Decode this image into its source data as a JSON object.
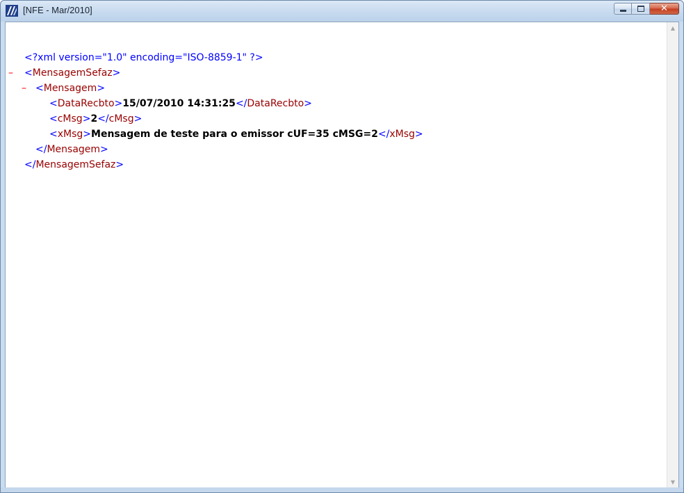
{
  "window": {
    "title": "[NFE - Mar/2010]",
    "icon": "app-logo-icon",
    "controls": [
      "minimize-icon",
      "maximize-icon",
      "close-icon"
    ]
  },
  "xml": {
    "pi": "<?xml version=\"1.0\" encoding=\"ISO-8859-1\" ?>",
    "collapse_glyph": "–",
    "root_open": "<MensagemSefaz>",
    "mensagem_open": "<Mensagem>",
    "datarecbto": {
      "open": "<DataRecbto>",
      "value": "15/07/2010 14:31:25",
      "close": "</DataRecbto>"
    },
    "cmsg": {
      "open": "<cMsg>",
      "value": "2",
      "close": "</cMsg>"
    },
    "xmsg": {
      "open": "<xMsg>",
      "value": "Mensagem de teste para o emissor cUF=35 cMSG=2",
      "close": "</xMsg>"
    },
    "mensagem_close": "</Mensagem>",
    "root_close": "</MensagemSefaz>"
  },
  "colors": {
    "tag": "#990000",
    "bracket": "#0000ff",
    "toggle": "#ff0000",
    "value": "#000000"
  }
}
